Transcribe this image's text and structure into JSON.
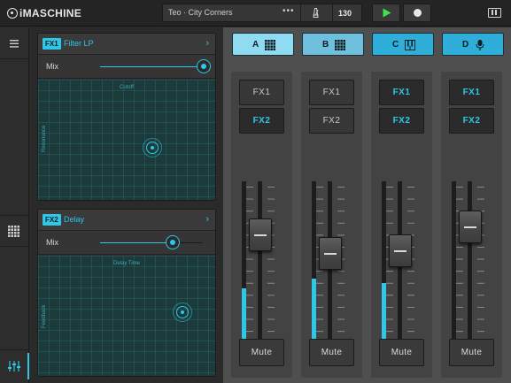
{
  "app": {
    "logo": "iMASCHINE"
  },
  "transport": {
    "project_name": "Teo · City Corners",
    "more": "•••",
    "tempo": "130"
  },
  "fx_panels": [
    {
      "tag": "FX1",
      "name": "Filter LP",
      "mix_label": "Mix",
      "mix_value": 1.0,
      "x_axis_label": "Cutoff",
      "y_axis_label": "Resonance"
    },
    {
      "tag": "FX2",
      "name": "Delay",
      "mix_label": "Mix",
      "mix_value": 0.71,
      "x_axis_label": "Delay Time",
      "y_axis_label": "Feedback"
    }
  ],
  "groups": [
    {
      "label": "A",
      "icon": "grid-icon",
      "color": "#8fdcf2",
      "selected": true
    },
    {
      "label": "B",
      "icon": "grid-icon",
      "color": "#6fc0dd",
      "selected": false
    },
    {
      "label": "C",
      "icon": "keyboard-icon",
      "color": "#2eaed8",
      "selected": false
    },
    {
      "label": "D",
      "icon": "microphone-icon",
      "color": "#2eaed8",
      "selected": false
    }
  ],
  "channels": [
    {
      "fx1": "FX1",
      "fx2": "FX2",
      "fx1_on": false,
      "fx2_on": true,
      "level": 0.35,
      "fader": 0.72,
      "mute": "Mute"
    },
    {
      "fx1": "FX1",
      "fx2": "FX2",
      "fx1_on": false,
      "fx2_on": false,
      "level": 0.41,
      "fader": 0.58,
      "mute": "Mute"
    },
    {
      "fx1": "FX1",
      "fx2": "FX2",
      "fx1_on": true,
      "fx2_on": true,
      "level": 0.38,
      "fader": 0.6,
      "mute": "Mute"
    },
    {
      "fx1": "FX1",
      "fx2": "FX2",
      "fx1_on": true,
      "fx2_on": true,
      "level": 0.0,
      "fader": 0.78,
      "mute": "Mute"
    }
  ],
  "colors": {
    "accent": "#2dc7e8",
    "background": "#2a2a2a",
    "mixer_bg": "#4f4f4f"
  }
}
